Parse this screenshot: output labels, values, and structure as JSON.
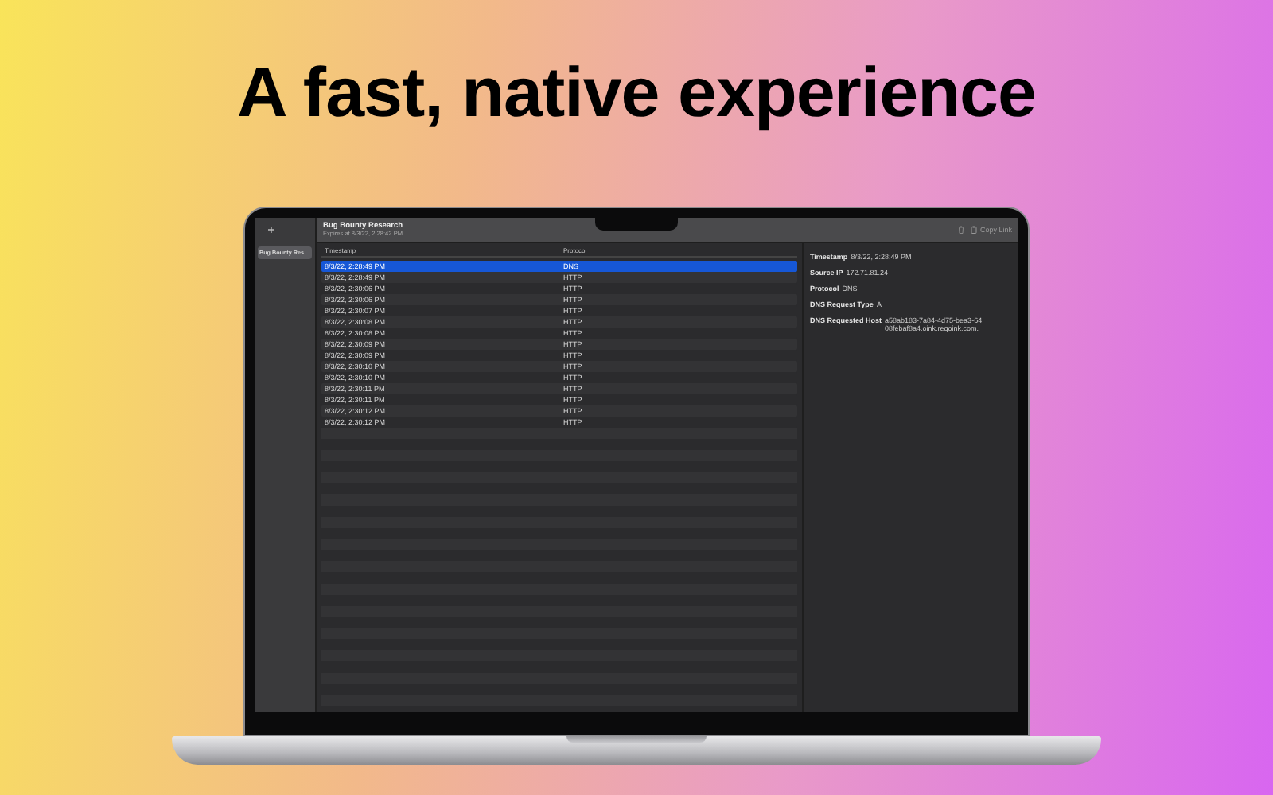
{
  "headline": "A fast, native experience",
  "sidebar": {
    "items": [
      {
        "label": "Bug Bounty Res...",
        "selected": true
      }
    ]
  },
  "toolbar": {
    "title": "Bug Bounty Research",
    "subtitle": "Expires at 8/3/22, 2:28:42 PM",
    "copy_link": "Copy Link"
  },
  "table": {
    "columns": [
      "Timestamp",
      "Protocol"
    ],
    "rows": [
      {
        "cells": [
          "8/3/22, 2:28:49 PM",
          "DNS"
        ],
        "selected": true
      },
      {
        "cells": [
          "8/3/22, 2:28:49 PM",
          "HTTP"
        ],
        "selected": false
      },
      {
        "cells": [
          "8/3/22, 2:30:06 PM",
          "HTTP"
        ],
        "selected": false
      },
      {
        "cells": [
          "8/3/22, 2:30:06 PM",
          "HTTP"
        ],
        "selected": false
      },
      {
        "cells": [
          "8/3/22, 2:30:07 PM",
          "HTTP"
        ],
        "selected": false
      },
      {
        "cells": [
          "8/3/22, 2:30:08 PM",
          "HTTP"
        ],
        "selected": false
      },
      {
        "cells": [
          "8/3/22, 2:30:08 PM",
          "HTTP"
        ],
        "selected": false
      },
      {
        "cells": [
          "8/3/22, 2:30:09 PM",
          "HTTP"
        ],
        "selected": false
      },
      {
        "cells": [
          "8/3/22, 2:30:09 PM",
          "HTTP"
        ],
        "selected": false
      },
      {
        "cells": [
          "8/3/22, 2:30:10 PM",
          "HTTP"
        ],
        "selected": false
      },
      {
        "cells": [
          "8/3/22, 2:30:10 PM",
          "HTTP"
        ],
        "selected": false
      },
      {
        "cells": [
          "8/3/22, 2:30:11 PM",
          "HTTP"
        ],
        "selected": false
      },
      {
        "cells": [
          "8/3/22, 2:30:11 PM",
          "HTTP"
        ],
        "selected": false
      },
      {
        "cells": [
          "8/3/22, 2:30:12 PM",
          "HTTP"
        ],
        "selected": false
      },
      {
        "cells": [
          "8/3/22, 2:30:12 PM",
          "HTTP"
        ],
        "selected": false
      }
    ]
  },
  "details": [
    {
      "label": "Timestamp",
      "value": "8/3/22, 2:28:49 PM"
    },
    {
      "label": "Source IP",
      "value": "172.71.81.24"
    },
    {
      "label": "Protocol",
      "value": "DNS"
    },
    {
      "label": "DNS Request Type",
      "value": "A"
    },
    {
      "label": "DNS Requested Host",
      "value": "a58ab183-7a84-4d75-bea3-6408febaf8a4.oink.reqoink.com."
    }
  ]
}
